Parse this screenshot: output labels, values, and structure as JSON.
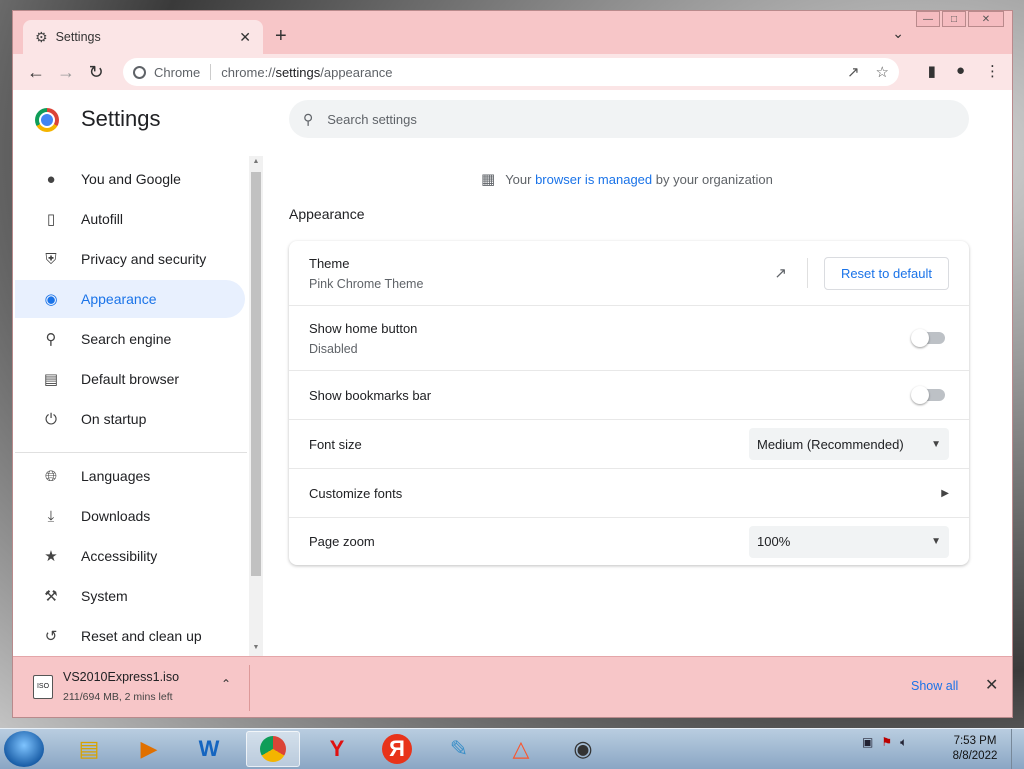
{
  "window": {
    "tab_title": "Settings",
    "omnibox_site": "Chrome",
    "url_prefix": "chrome://",
    "url_host": "settings",
    "url_path": "/appearance"
  },
  "page": {
    "title": "Settings",
    "search_placeholder": "Search settings",
    "managed_prefix": "Your ",
    "managed_link": "browser is managed",
    "managed_suffix": " by your organization",
    "section_title": "Appearance"
  },
  "sidebar": {
    "items": [
      {
        "label": "You and Google",
        "icon": "person-icon"
      },
      {
        "label": "Autofill",
        "icon": "clipboard-icon"
      },
      {
        "label": "Privacy and security",
        "icon": "shield-icon"
      },
      {
        "label": "Appearance",
        "icon": "palette-icon"
      },
      {
        "label": "Search engine",
        "icon": "search-icon"
      },
      {
        "label": "Default browser",
        "icon": "browser-icon"
      },
      {
        "label": "On startup",
        "icon": "power-icon"
      },
      {
        "label": "Languages",
        "icon": "globe-icon"
      },
      {
        "label": "Downloads",
        "icon": "download-icon"
      },
      {
        "label": "Accessibility",
        "icon": "accessibility-icon"
      },
      {
        "label": "System",
        "icon": "wrench-icon"
      },
      {
        "label": "Reset and clean up",
        "icon": "restore-icon"
      }
    ]
  },
  "settings": {
    "theme_label": "Theme",
    "theme_value": "Pink Chrome Theme",
    "reset_button": "Reset to default",
    "home_label": "Show home button",
    "home_value": "Disabled",
    "bookmarks_label": "Show bookmarks bar",
    "font_size_label": "Font size",
    "font_size_value": "Medium (Recommended)",
    "customize_fonts_label": "Customize fonts",
    "page_zoom_label": "Page zoom",
    "page_zoom_value": "100%"
  },
  "download": {
    "filename": "VS2010Express1.iso",
    "status": "211/694 MB, 2 mins left",
    "show_all": "Show all"
  },
  "taskbar": {
    "time": "7:53 PM",
    "date": "8/8/2022"
  },
  "colors": {
    "frame": "#f7c6c8",
    "accent": "#1a73e8",
    "active_nav_bg": "#e8f0fe"
  }
}
